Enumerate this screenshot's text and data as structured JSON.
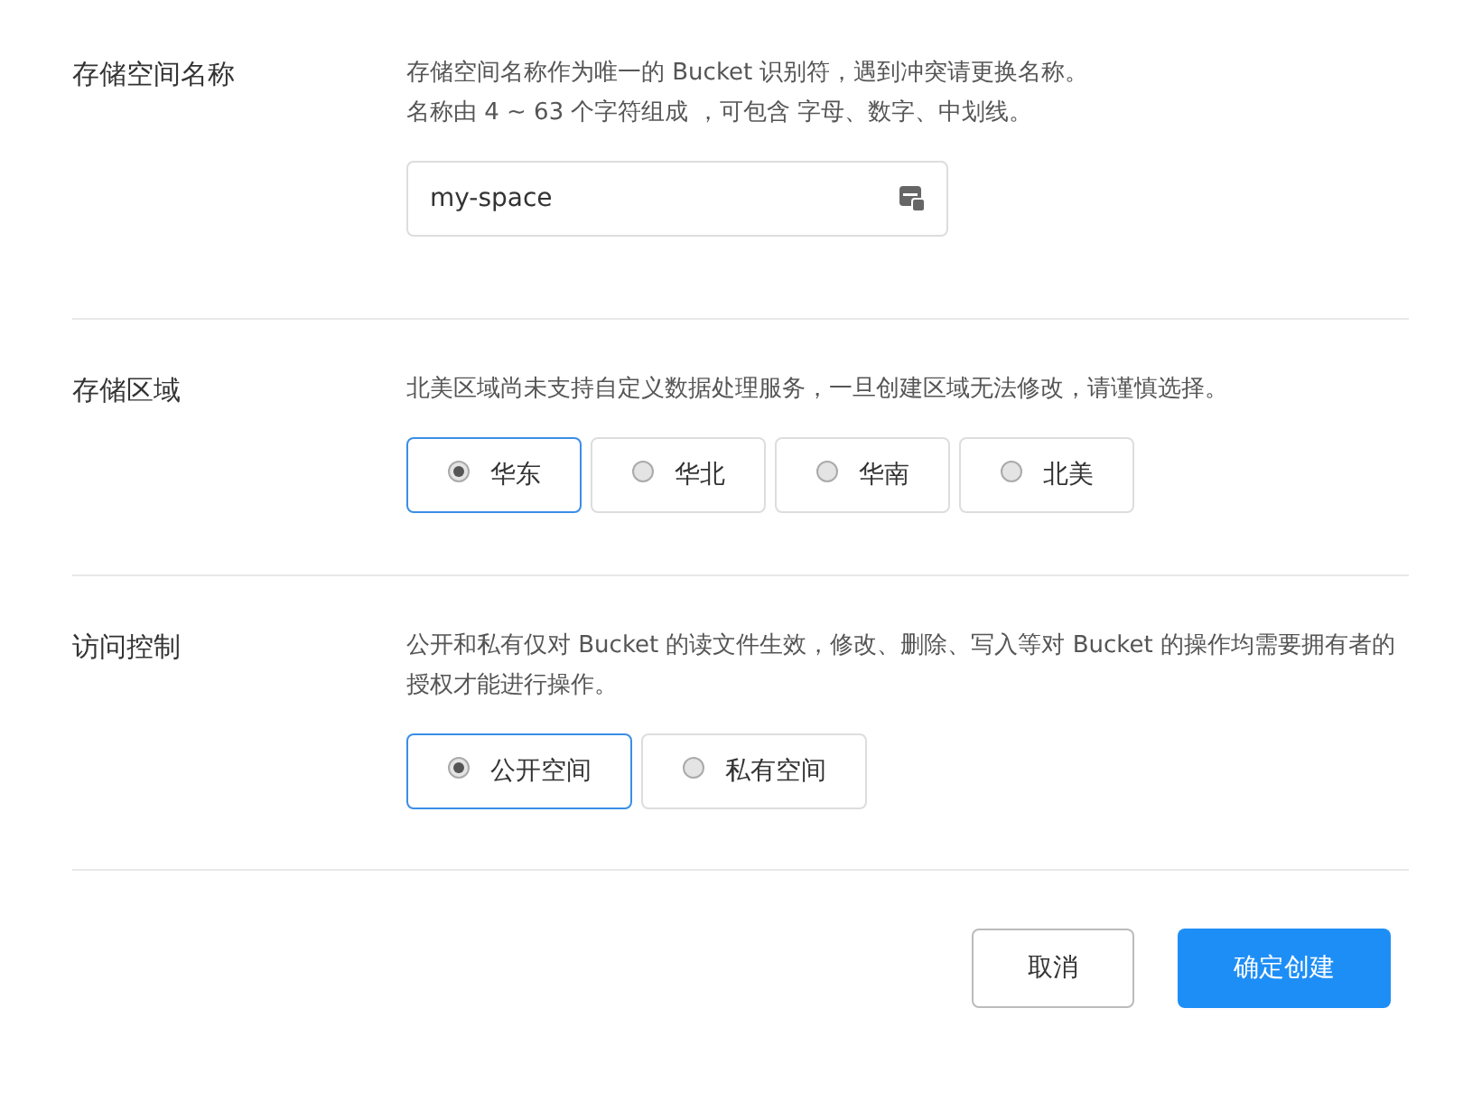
{
  "sections": [
    {
      "label": "存储空间名称",
      "kind": "input",
      "description": [
        "存储空间名称作为唯一的 Bucket 识别符，遇到冲突请更换名称。",
        "名称由 4 ~ 63 个字符组成 ，可包含 字母、数字、中划线。"
      ],
      "value": "my-space"
    },
    {
      "label": "存储区域",
      "kind": "radio",
      "description": [
        "北美区域尚未支持自定义数据处理服务，一旦创建区域无法修改，请谨慎选择。"
      ],
      "options": [
        {
          "label": "华东",
          "selected": true
        },
        {
          "label": "华北",
          "selected": false
        },
        {
          "label": "华南",
          "selected": false
        },
        {
          "label": "北美",
          "selected": false
        }
      ]
    },
    {
      "label": "访问控制",
      "kind": "radio",
      "description": [
        "公开和私有仅对 Bucket 的读文件生效，修改、删除、写入等对 Bucket 的操作均需要拥有者的授权才能进行操作。"
      ],
      "options": [
        {
          "label": "公开空间",
          "selected": true
        },
        {
          "label": "私有空间",
          "selected": false
        }
      ]
    }
  ],
  "buttons": [
    {
      "label": "取消",
      "kind": "secondary"
    },
    {
      "label": "确定创建",
      "kind": "primary"
    }
  ]
}
